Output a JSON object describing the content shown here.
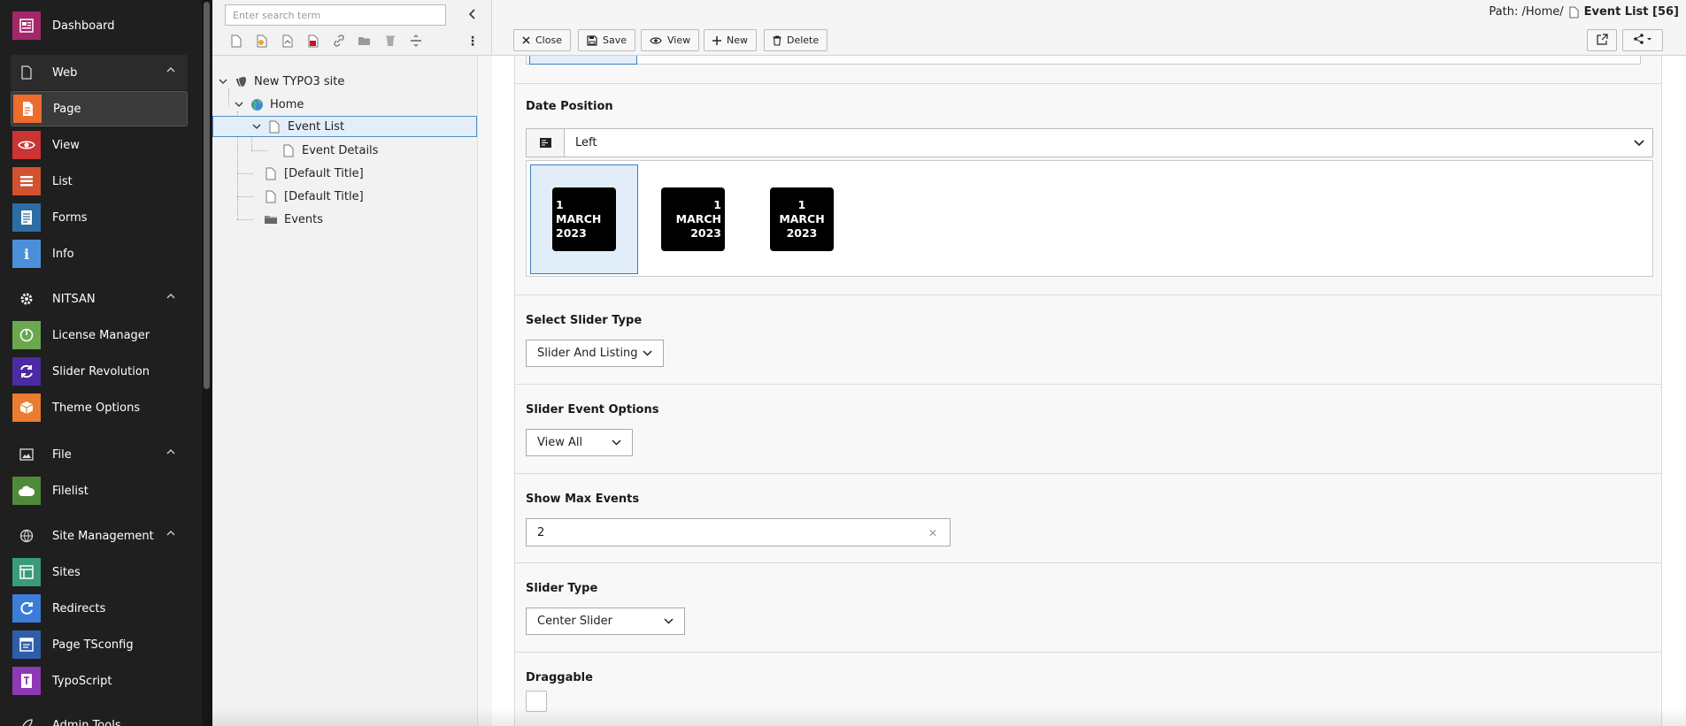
{
  "module_menu": {
    "dashboard": {
      "label": "Dashboard",
      "color": "#a4276a",
      "icon": "dashboard-icon"
    },
    "groups": {
      "web": {
        "label": "Web",
        "icon": "page-icon"
      },
      "nitsan": {
        "label": "NITSAN",
        "icon": "gear-icon"
      },
      "file": {
        "label": "File",
        "icon": "image-icon"
      },
      "site_management": {
        "label": "Site Management",
        "icon": "globe-icon"
      },
      "admin_tools": {
        "label": "Admin Tools",
        "icon": "rocket-icon"
      }
    },
    "items": {
      "page": {
        "label": "Page",
        "color": "#ec6d2e",
        "icon": "page-module-icon"
      },
      "view": {
        "label": "View",
        "color": "#cc3333",
        "icon": "eye-icon"
      },
      "list": {
        "label": "List",
        "color": "#d2522f",
        "icon": "list-icon"
      },
      "forms": {
        "label": "Forms",
        "color": "#2e6da4",
        "icon": "form-icon"
      },
      "info": {
        "label": "Info",
        "color": "#4a90d9",
        "icon": "info-icon"
      },
      "license_manager": {
        "label": "License Manager",
        "color": "#6aa84f",
        "icon": "power-icon"
      },
      "slider_revolution": {
        "label": "Slider Revolution",
        "color": "#4b2aa3",
        "icon": "refresh-icon"
      },
      "theme_options": {
        "label": "Theme Options",
        "color": "#ec7d2e",
        "icon": "box-icon"
      },
      "filelist": {
        "label": "Filelist",
        "color": "#4f8a3a",
        "icon": "cloud-icon"
      },
      "sites": {
        "label": "Sites",
        "color": "#3a9b7a",
        "icon": "sites-icon"
      },
      "redirects": {
        "label": "Redirects",
        "color": "#3c7dd9",
        "icon": "redirect-icon"
      },
      "page_tsconfig": {
        "label": "Page TSconfig",
        "color": "#2f5ea8",
        "icon": "tsconfig-icon"
      },
      "typoscript": {
        "label": "TypoScript",
        "color": "#8f3ab5",
        "icon": "typoscript-icon"
      }
    }
  },
  "page_tree": {
    "search_placeholder": "Enter search term",
    "nodes": {
      "root": "New TYPO3 site",
      "home": "Home",
      "event_list": "Event List",
      "event_details": "Event Details",
      "default_title_1": "[Default Title]",
      "default_title_2": "[Default Title]",
      "events": "Events"
    }
  },
  "header": {
    "path_prefix": "Path: /Home/",
    "current_page": "Event List [56]",
    "buttons": {
      "close": "Close",
      "save": "Save",
      "view": "View",
      "new": "New",
      "delete": "Delete"
    }
  },
  "form": {
    "date_position": {
      "label": "Date Position",
      "selected": "Left",
      "options": [
        {
          "day": "1",
          "month": "MARCH",
          "year": "2023",
          "align": "left"
        },
        {
          "day": "1",
          "month": "MARCH",
          "year": "2023",
          "align": "right"
        },
        {
          "day": "1",
          "month": "MARCH",
          "year": "2023",
          "align": "center"
        }
      ]
    },
    "select_slider_type": {
      "label": "Select Slider Type",
      "value": "Slider And Listing"
    },
    "slider_event_options": {
      "label": "Slider Event Options",
      "value": "View All"
    },
    "show_max_events": {
      "label": "Show Max Events",
      "value": "2"
    },
    "slider_type": {
      "label": "Slider Type",
      "value": "Center Slider"
    },
    "draggable": {
      "label": "Draggable",
      "checked": false
    }
  }
}
